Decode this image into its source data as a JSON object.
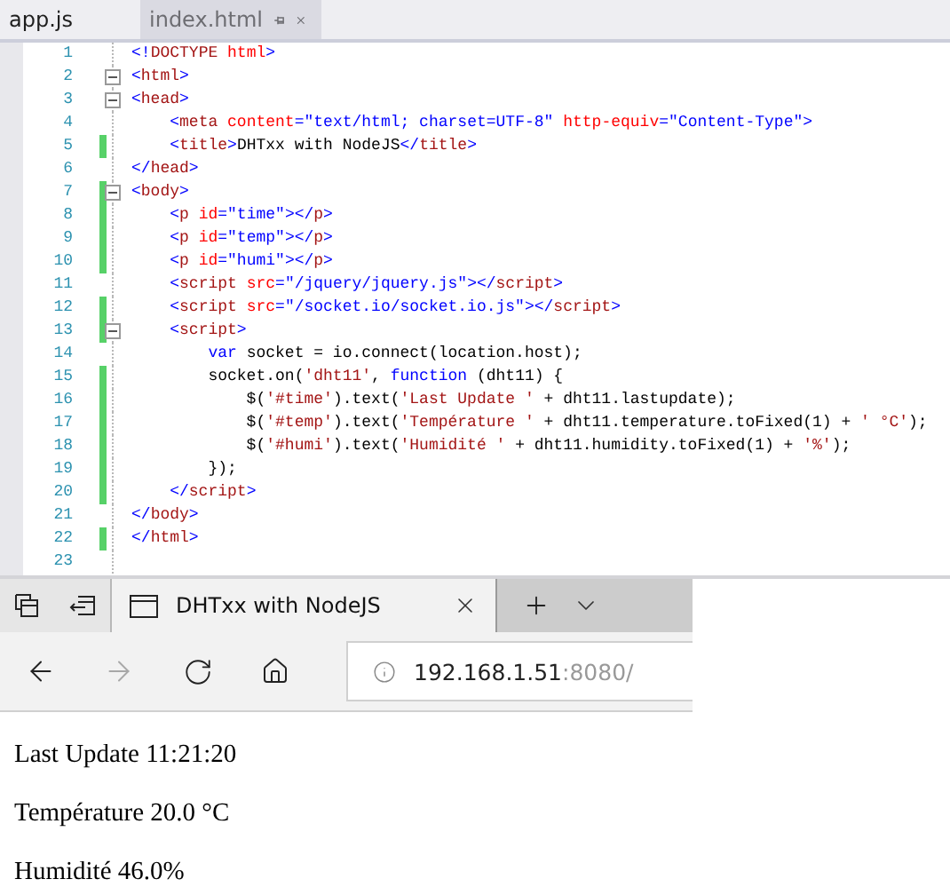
{
  "editor": {
    "tabs": [
      {
        "label": "app.js",
        "selected": false
      },
      {
        "label": "index.html",
        "selected": true
      }
    ],
    "lines": [
      {
        "number": "1",
        "changed": false,
        "fold": false,
        "tokens": [
          {
            "kind": "punct",
            "text": "<!"
          },
          {
            "kind": "tag",
            "text": "DOCTYPE"
          },
          {
            "kind": "attr",
            "text": " html"
          },
          {
            "kind": "punct",
            "text": ">"
          }
        ]
      },
      {
        "number": "2",
        "changed": false,
        "fold": true,
        "tokens": [
          {
            "kind": "punct",
            "text": "<"
          },
          {
            "kind": "tag",
            "text": "html"
          },
          {
            "kind": "punct",
            "text": ">"
          }
        ]
      },
      {
        "number": "3",
        "changed": false,
        "fold": true,
        "tokens": [
          {
            "kind": "punct",
            "text": "<"
          },
          {
            "kind": "tag",
            "text": "head"
          },
          {
            "kind": "punct",
            "text": ">"
          }
        ]
      },
      {
        "number": "4",
        "changed": false,
        "fold": false,
        "tokens": [
          {
            "kind": "punct",
            "text": "    <"
          },
          {
            "kind": "tag",
            "text": "meta"
          },
          {
            "kind": "attr",
            "text": " content"
          },
          {
            "kind": "punct",
            "text": "="
          },
          {
            "kind": "str",
            "text": "\"text/html; charset=UTF-8\""
          },
          {
            "kind": "attr",
            "text": " http-equiv"
          },
          {
            "kind": "punct",
            "text": "="
          },
          {
            "kind": "str",
            "text": "\"Content-Type\""
          },
          {
            "kind": "punct",
            "text": ">"
          }
        ]
      },
      {
        "number": "5",
        "changed": true,
        "fold": false,
        "tokens": [
          {
            "kind": "punct",
            "text": "    <"
          },
          {
            "kind": "tag",
            "text": "title"
          },
          {
            "kind": "punct",
            "text": ">"
          },
          {
            "kind": "plain",
            "text": "DHTxx with NodeJS"
          },
          {
            "kind": "punct",
            "text": "</"
          },
          {
            "kind": "tag",
            "text": "title"
          },
          {
            "kind": "punct",
            "text": ">"
          }
        ]
      },
      {
        "number": "6",
        "changed": false,
        "fold": false,
        "tokens": [
          {
            "kind": "punct",
            "text": "</"
          },
          {
            "kind": "tag",
            "text": "head"
          },
          {
            "kind": "punct",
            "text": ">"
          }
        ]
      },
      {
        "number": "7",
        "changed": true,
        "fold": true,
        "tokens": [
          {
            "kind": "punct",
            "text": "<"
          },
          {
            "kind": "tag",
            "text": "body"
          },
          {
            "kind": "punct",
            "text": ">"
          }
        ]
      },
      {
        "number": "8",
        "changed": true,
        "fold": false,
        "tokens": [
          {
            "kind": "punct",
            "text": "    <"
          },
          {
            "kind": "tag",
            "text": "p"
          },
          {
            "kind": "attr",
            "text": " id"
          },
          {
            "kind": "punct",
            "text": "="
          },
          {
            "kind": "str",
            "text": "\"time\""
          },
          {
            "kind": "punct",
            "text": "></"
          },
          {
            "kind": "tag",
            "text": "p"
          },
          {
            "kind": "punct",
            "text": ">"
          }
        ]
      },
      {
        "number": "9",
        "changed": true,
        "fold": false,
        "tokens": [
          {
            "kind": "punct",
            "text": "    <"
          },
          {
            "kind": "tag",
            "text": "p"
          },
          {
            "kind": "attr",
            "text": " id"
          },
          {
            "kind": "punct",
            "text": "="
          },
          {
            "kind": "str",
            "text": "\"temp\""
          },
          {
            "kind": "punct",
            "text": "></"
          },
          {
            "kind": "tag",
            "text": "p"
          },
          {
            "kind": "punct",
            "text": ">"
          }
        ]
      },
      {
        "number": "10",
        "changed": true,
        "fold": false,
        "tokens": [
          {
            "kind": "punct",
            "text": "    <"
          },
          {
            "kind": "tag",
            "text": "p"
          },
          {
            "kind": "attr",
            "text": " id"
          },
          {
            "kind": "punct",
            "text": "="
          },
          {
            "kind": "str",
            "text": "\"humi\""
          },
          {
            "kind": "punct",
            "text": "></"
          },
          {
            "kind": "tag",
            "text": "p"
          },
          {
            "kind": "punct",
            "text": ">"
          }
        ]
      },
      {
        "number": "11",
        "changed": false,
        "fold": false,
        "tokens": [
          {
            "kind": "punct",
            "text": "    <"
          },
          {
            "kind": "tag",
            "text": "script"
          },
          {
            "kind": "attr",
            "text": " src"
          },
          {
            "kind": "punct",
            "text": "="
          },
          {
            "kind": "str",
            "text": "\"/jquery/jquery.js\""
          },
          {
            "kind": "punct",
            "text": "></"
          },
          {
            "kind": "tag",
            "text": "script"
          },
          {
            "kind": "punct",
            "text": ">"
          }
        ]
      },
      {
        "number": "12",
        "changed": true,
        "fold": false,
        "tokens": [
          {
            "kind": "punct",
            "text": "    <"
          },
          {
            "kind": "tag",
            "text": "script"
          },
          {
            "kind": "attr",
            "text": " src"
          },
          {
            "kind": "punct",
            "text": "="
          },
          {
            "kind": "str",
            "text": "\"/socket.io/socket.io.js\""
          },
          {
            "kind": "punct",
            "text": "></"
          },
          {
            "kind": "tag",
            "text": "script"
          },
          {
            "kind": "punct",
            "text": ">"
          }
        ]
      },
      {
        "number": "13",
        "changed": true,
        "fold": true,
        "tokens": [
          {
            "kind": "punct",
            "text": "    <"
          },
          {
            "kind": "tag",
            "text": "script"
          },
          {
            "kind": "punct",
            "text": ">"
          }
        ]
      },
      {
        "number": "14",
        "changed": false,
        "fold": false,
        "tokens": [
          {
            "kind": "kw",
            "text": "        var"
          },
          {
            "kind": "plain",
            "text": " socket = io.connect(location.host);"
          }
        ]
      },
      {
        "number": "15",
        "changed": true,
        "fold": false,
        "tokens": [
          {
            "kind": "plain",
            "text": "        socket.on("
          },
          {
            "kind": "jsstr",
            "text": "'dht11'"
          },
          {
            "kind": "plain",
            "text": ", "
          },
          {
            "kind": "kw",
            "text": "function"
          },
          {
            "kind": "plain",
            "text": " (dht11) {"
          }
        ]
      },
      {
        "number": "16",
        "changed": true,
        "fold": false,
        "tokens": [
          {
            "kind": "plain",
            "text": "            $("
          },
          {
            "kind": "jsstr",
            "text": "'#time'"
          },
          {
            "kind": "plain",
            "text": ").text("
          },
          {
            "kind": "jsstr",
            "text": "'Last Update '"
          },
          {
            "kind": "plain",
            "text": " + dht11.lastupdate);"
          }
        ]
      },
      {
        "number": "17",
        "changed": true,
        "fold": false,
        "tokens": [
          {
            "kind": "plain",
            "text": "            $("
          },
          {
            "kind": "jsstr",
            "text": "'#temp'"
          },
          {
            "kind": "plain",
            "text": ").text("
          },
          {
            "kind": "jsstr",
            "text": "'Température '"
          },
          {
            "kind": "plain",
            "text": " + dht11.temperature.toFixed(1) + "
          },
          {
            "kind": "jsstr",
            "text": "' °C'"
          },
          {
            "kind": "plain",
            "text": ");"
          }
        ]
      },
      {
        "number": "18",
        "changed": true,
        "fold": false,
        "tokens": [
          {
            "kind": "plain",
            "text": "            $("
          },
          {
            "kind": "jsstr",
            "text": "'#humi'"
          },
          {
            "kind": "plain",
            "text": ").text("
          },
          {
            "kind": "jsstr",
            "text": "'Humidité '"
          },
          {
            "kind": "plain",
            "text": " + dht11.humidity.toFixed(1) + "
          },
          {
            "kind": "jsstr",
            "text": "'%'"
          },
          {
            "kind": "plain",
            "text": ");"
          }
        ]
      },
      {
        "number": "19",
        "changed": true,
        "fold": false,
        "tokens": [
          {
            "kind": "plain",
            "text": "        });"
          }
        ]
      },
      {
        "number": "20",
        "changed": true,
        "fold": false,
        "tokens": [
          {
            "kind": "punct",
            "text": "    </"
          },
          {
            "kind": "tag",
            "text": "script"
          },
          {
            "kind": "punct",
            "text": ">"
          }
        ]
      },
      {
        "number": "21",
        "changed": false,
        "fold": false,
        "tokens": [
          {
            "kind": "punct",
            "text": "</"
          },
          {
            "kind": "tag",
            "text": "body"
          },
          {
            "kind": "punct",
            "text": ">"
          }
        ]
      },
      {
        "number": "22",
        "changed": true,
        "fold": false,
        "tokens": [
          {
            "kind": "punct",
            "text": "</"
          },
          {
            "kind": "tag",
            "text": "html"
          },
          {
            "kind": "punct",
            "text": ">"
          }
        ]
      },
      {
        "number": "23",
        "changed": false,
        "fold": false
      }
    ]
  },
  "browser": {
    "tab": {
      "title": "DHTxx with NodeJS"
    },
    "nav": [
      {
        "kind": "back",
        "disabled": false
      },
      {
        "kind": "forward",
        "disabled": true
      },
      {
        "kind": "refresh",
        "disabled": false
      },
      {
        "kind": "home",
        "disabled": false
      }
    ],
    "address": {
      "host": "192.168.1.51",
      "rest": ":8080/"
    },
    "content": [
      "Last Update 11:21:20",
      "Température 20.0 °C",
      "Humidité 46.0%"
    ]
  }
}
